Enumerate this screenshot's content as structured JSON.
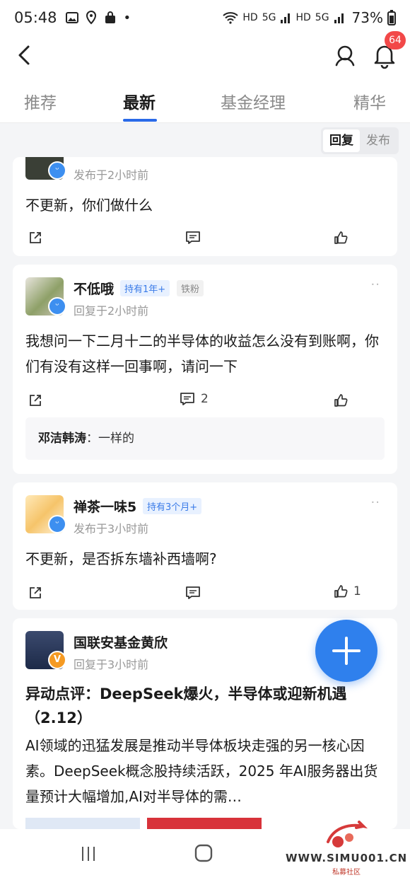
{
  "status": {
    "time": "05:48",
    "net1": "HD",
    "net2": "5G",
    "net3": "HD",
    "net4": "5G",
    "battery": "73%"
  },
  "notifications": {
    "count": "64"
  },
  "tabs": [
    {
      "label": "推荐"
    },
    {
      "label": "最新"
    },
    {
      "label": "基金经理"
    },
    {
      "label": "精华"
    }
  ],
  "sort": {
    "reply": "回复",
    "publish": "发布"
  },
  "posts": [
    {
      "meta": "发布于2小时前",
      "body": "不更新，你们做什么",
      "share": "",
      "comment": "",
      "like": ""
    },
    {
      "name": "不低哦",
      "tag1": "持有1年+",
      "tag2": "铁粉",
      "meta": "回复于2小时前",
      "more": "··",
      "body": "我想问一下二月十二的半导体的收益怎么没有到账啊，你们有没有这样一回事啊，请问一下",
      "comment": "2",
      "reply_author": "邓洁韩涛",
      "reply_text": "：一样的"
    },
    {
      "name": "禅茶一味5",
      "tag1": "持有3个月+",
      "meta": "发布于3小时前",
      "more": "··",
      "body": "不更新，是否拆东墙补西墙啊?",
      "like": "1"
    },
    {
      "name": "国联安基金黄欣",
      "meta": "回复于3小时前",
      "verified": "V",
      "title": "异动点评：DeepSeek爆火，半导体或迎新机遇（2.12）",
      "body": "AI领域的迅猛发展是推动半导体板块走强的另一核心因素。DeepSeek概念股持续活跃，2025 年AI服务器出货量预计大幅增加,AI对半导体的需…"
    }
  ],
  "watermark": {
    "text": "WWW.SIMU001.CN",
    "sub": "私募社区"
  },
  "colors": {
    "accent": "#2a6ae8",
    "fab": "#2f80ed",
    "badge": "#f24848"
  }
}
